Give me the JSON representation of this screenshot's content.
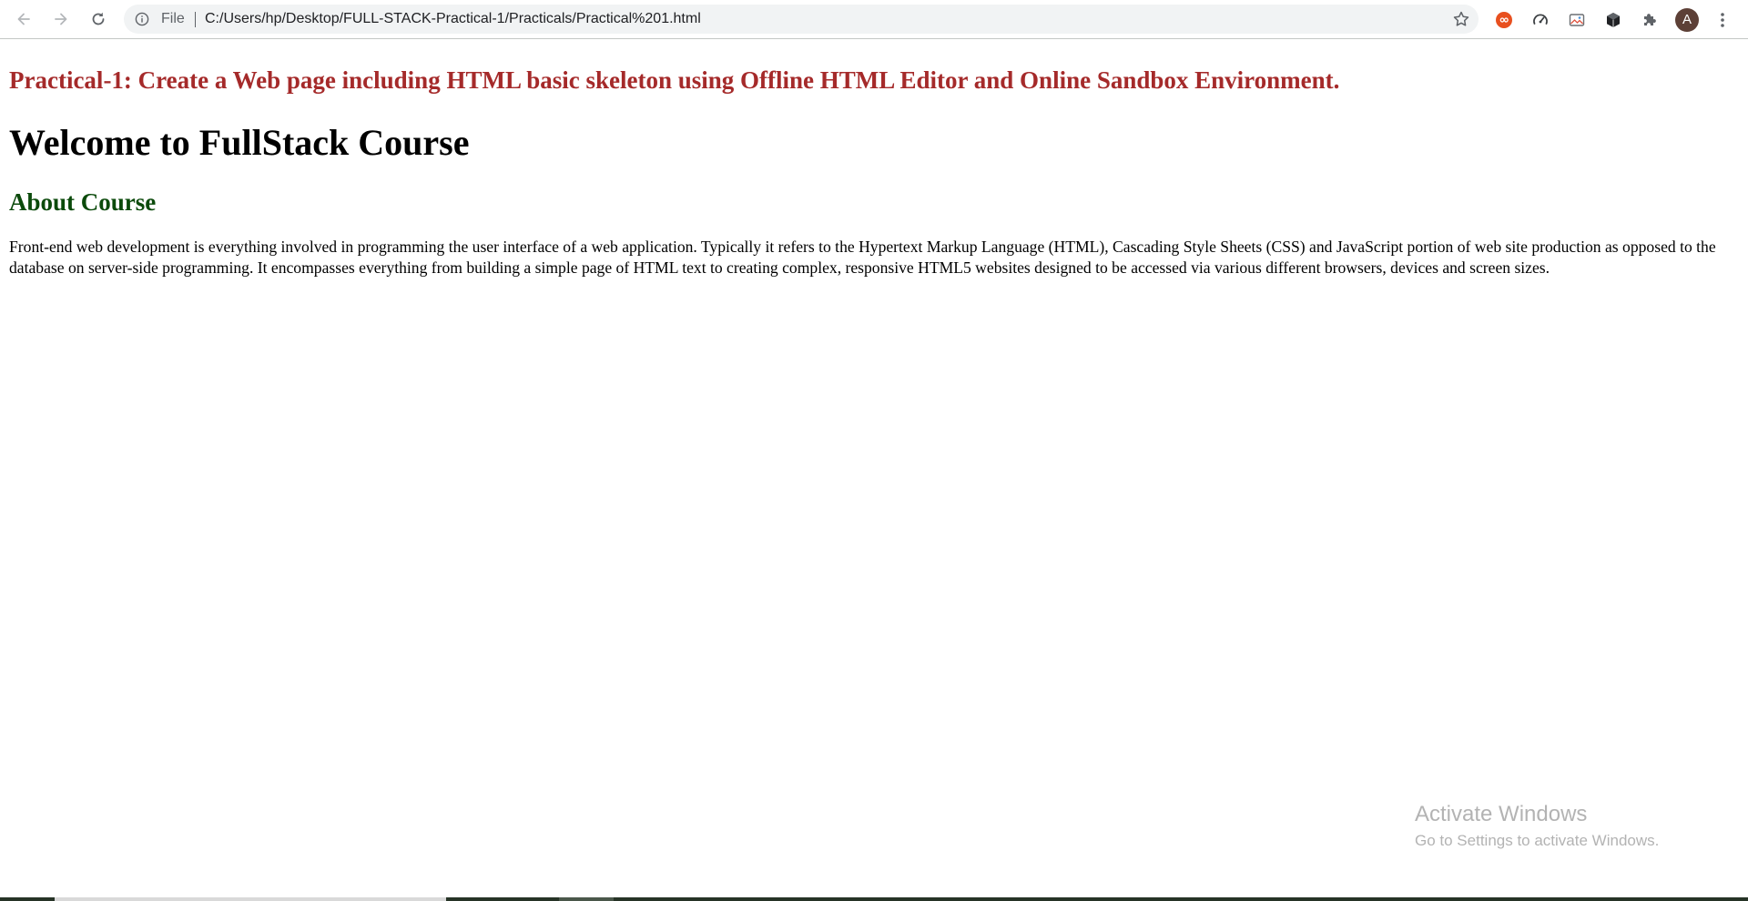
{
  "browser": {
    "address_scheme": "File",
    "address_url": "C:/Users/hp/Desktop/FULL-STACK-Practical-1/Practicals/Practical%201.html",
    "profile_initial": "A",
    "icons": {
      "back": "back-arrow-icon",
      "forward": "forward-arrow-icon",
      "reload": "reload-icon",
      "info": "info-icon",
      "bookmark": "star-icon",
      "extensions": [
        "infinity-extension-icon",
        "speedometer-extension-icon",
        "image-extension-icon",
        "cube-extension-icon",
        "puzzle-extensions-icon"
      ],
      "menu": "kebab-menu-icon"
    }
  },
  "page": {
    "practical_title": "Practical-1: Create a Web page including HTML basic skeleton using Offline HTML Editor and Online Sandbox Environment.",
    "welcome_heading": "Welcome to FullStack Course",
    "about_heading": "About Course",
    "paragraph": "Front-end web development is everything involved in programming the user interface of a web application. Typically it refers to the Hypertext Markup Language (HTML), Cascading Style Sheets (CSS) and JavaScript portion of web site production as opposed to the database on server-side programming. It encompasses everything from building a simple page of HTML text to creating complex, responsive HTML5 websites designed to be accessed via various different browsers, devices and screen sizes."
  },
  "watermark": {
    "title": "Activate Windows",
    "subtitle": "Go to Settings to activate Windows."
  },
  "colors": {
    "practical_title": "#a52a2a",
    "about_heading": "#0b4a0b",
    "omnibox_bg": "#f1f3f4",
    "avatar_bg": "#5d4037"
  }
}
